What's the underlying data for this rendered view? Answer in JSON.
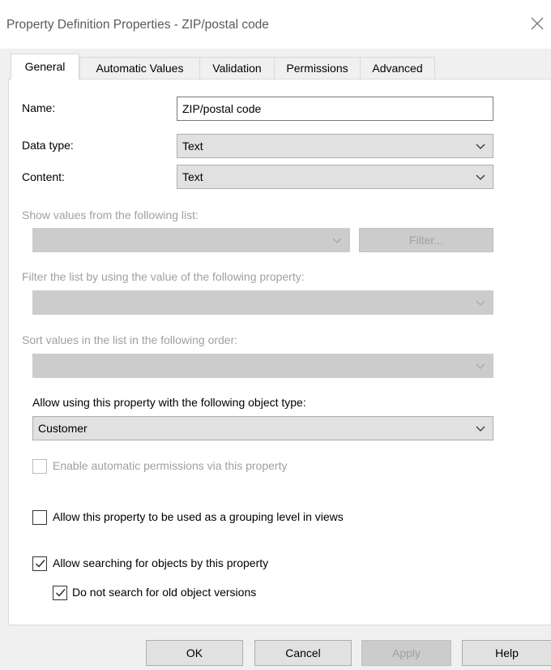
{
  "window": {
    "title": "Property Definition Properties - ZIP/postal code",
    "close_icon": "close-icon"
  },
  "tabs": [
    {
      "label": "General",
      "active": true
    },
    {
      "label": "Automatic Values"
    },
    {
      "label": "Validation"
    },
    {
      "label": "Permissions"
    },
    {
      "label": "Advanced"
    }
  ],
  "form": {
    "name_label": "Name:",
    "name_value": "ZIP/postal code",
    "data_type_label": "Data type:",
    "data_type_value": "Text",
    "content_label": "Content:",
    "content_value": "Text",
    "show_values_label": "Show values from the following list:",
    "show_values_value": "",
    "filter_button": "Filter...",
    "filter_list_label": "Filter the list by using the value of the following property:",
    "filter_list_value": "",
    "sort_values_label": "Sort values in the list in the following order:",
    "sort_values_value": "",
    "object_type_label": "Allow using this property with the following object type:",
    "object_type_value": "Customer",
    "auto_permissions_label": "Enable automatic permissions via this property",
    "auto_permissions_checked": false,
    "grouping_label": "Allow this property to be used as a grouping level in views",
    "grouping_checked": false,
    "searching_label": "Allow searching for objects by this property",
    "searching_checked": true,
    "old_versions_label": "Do not search for old object versions",
    "old_versions_checked": true
  },
  "buttons": {
    "ok": "OK",
    "cancel": "Cancel",
    "apply": "Apply",
    "help": "Help"
  },
  "colors": {
    "window_bg": "#f0f0f0",
    "panel_bg": "#ffffff",
    "disabled_text": "#a0a0a0",
    "combo_bg": "#e1e1e1"
  }
}
